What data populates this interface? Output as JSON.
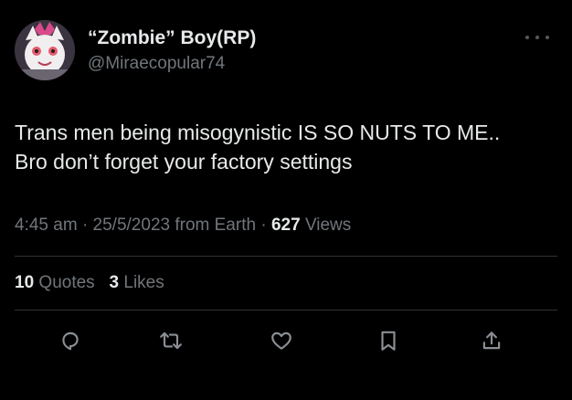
{
  "tweet": {
    "display_name": "“Zombie” Boy(RP)",
    "handle": "@Miraecopular74",
    "text_lines": [
      "Trans men being misogynistic IS SO NUTS TO ME..",
      "Bro don’t forget your factory settings"
    ],
    "time": "4:45 am",
    "date": "25/5/2023",
    "source": "from Earth",
    "views_count": "627",
    "views_label": "Views",
    "separator": "·",
    "quotes_count": "10",
    "quotes_label": "Quotes",
    "likes_count": "3",
    "likes_label": "Likes"
  },
  "icons": {
    "more": "more-dots-icon",
    "reply": "reply-icon",
    "retweet": "retweet-icon",
    "like": "heart-icon",
    "bookmark": "bookmark-icon",
    "share": "share-icon"
  },
  "colors": {
    "background": "#000000",
    "primary_text": "#e7e9ea",
    "secondary_text": "#71767b",
    "divider": "#2f3336"
  }
}
